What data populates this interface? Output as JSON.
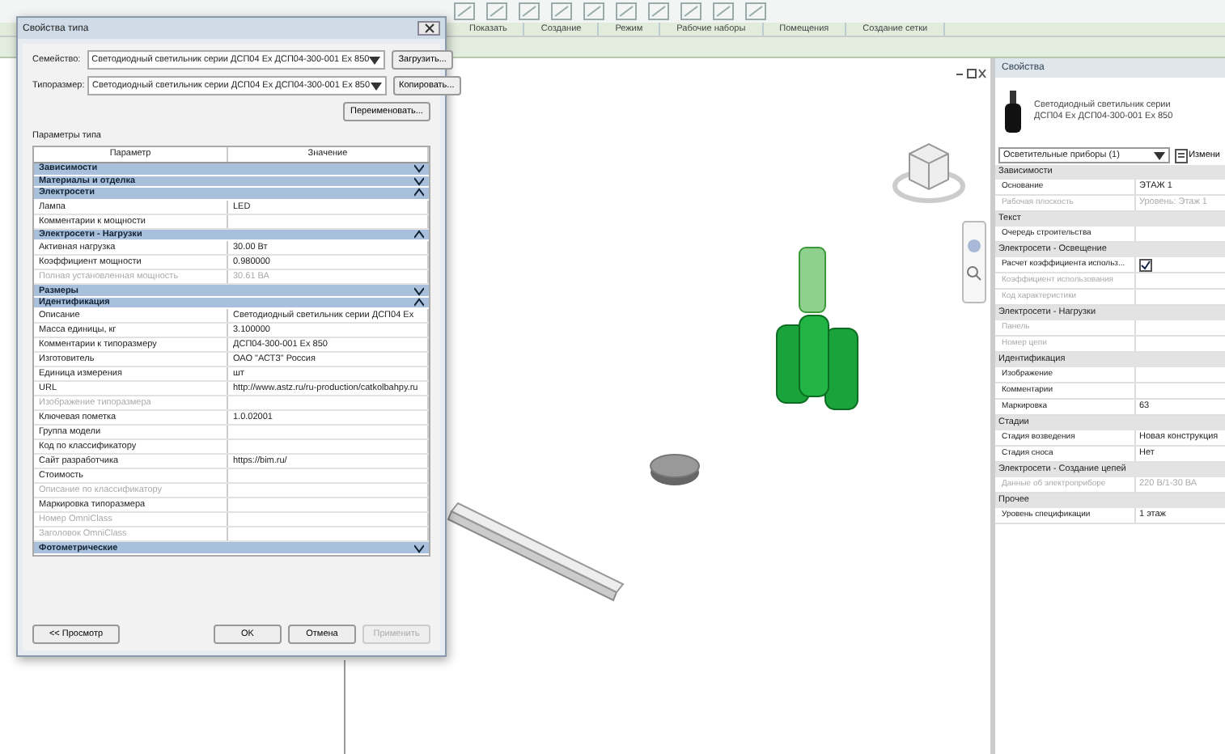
{
  "ribbon": {
    "panels": [
      {
        "label": "Показать"
      },
      {
        "label": "Создание"
      },
      {
        "label": "Режим"
      },
      {
        "label": "Рабочие наборы"
      },
      {
        "label": "Помещения"
      },
      {
        "label": "Создание сетки"
      }
    ]
  },
  "dialog": {
    "title": "Свойства типа",
    "family_label": "Семейство:",
    "family_value": "Светодиодный светильник серии ДСП04 Ex ДСП04-300-001 Ex 850",
    "type_label": "Типоразмер:",
    "type_value": "Светодиодный светильник серии ДСП04 Ex ДСП04-300-001 Ex 850",
    "side_buttons": [
      "Загрузить...",
      "Копировать...",
      "Переименовать..."
    ],
    "section_label": "Параметры типа",
    "columns": [
      "Параметр",
      "Значение"
    ],
    "groups": [
      {
        "name": "Зависимости",
        "expanded": false
      },
      {
        "name": "Материалы и отделка",
        "expanded": false
      },
      {
        "name": "Электросети",
        "expanded": true,
        "rows": [
          {
            "name": "Лампа",
            "value": "LED",
            "disabled": false
          },
          {
            "name": "Комментарии к мощности",
            "value": "",
            "disabled": false
          }
        ]
      },
      {
        "name": "Электросети - Нагрузки",
        "expanded": true,
        "rows": [
          {
            "name": "Активная нагрузка",
            "value": "30.00 Вт",
            "disabled": false
          },
          {
            "name": "Коэффициент мощности",
            "value": "0.980000",
            "disabled": false
          },
          {
            "name": "Полная установленная мощность",
            "value": "30.61 ВА",
            "disabled": true
          }
        ]
      },
      {
        "name": "Размеры",
        "expanded": false
      },
      {
        "name": "Идентификация",
        "expanded": true,
        "rows": [
          {
            "name": "Описание",
            "value": "Светодиодный светильник серии ДСП04 Ex",
            "disabled": false
          },
          {
            "name": "Масса единицы, кг",
            "value": "3.100000",
            "disabled": false
          },
          {
            "name": "Комментарии к типоразмеру",
            "value": "ДСП04-300-001 Ex 850",
            "disabled": false
          },
          {
            "name": "Изготовитель",
            "value": "ОАО \"АСТЗ\" Россия",
            "disabled": false
          },
          {
            "name": "Единица измерения",
            "value": "шт",
            "disabled": false
          },
          {
            "name": "URL",
            "value": "http://www.astz.ru/ru-production/catkolbahpy.ru",
            "disabled": false
          },
          {
            "name": "Изображение типоразмера",
            "value": "",
            "disabled": true
          },
          {
            "name": "Ключевая пометка",
            "value": "1.0.02001",
            "disabled": false
          },
          {
            "name": "Группа модели",
            "value": "",
            "disabled": false
          },
          {
            "name": "Код по классификатору",
            "value": "",
            "disabled": false
          },
          {
            "name": "Сайт разработчика",
            "value": "https://bim.ru/",
            "disabled": false
          },
          {
            "name": "Стоимость",
            "value": "",
            "disabled": false
          },
          {
            "name": "Описание по классификатору",
            "value": "",
            "disabled": true
          },
          {
            "name": "Маркировка типоразмера",
            "value": "",
            "disabled": false
          },
          {
            "name": "Номер OmniClass",
            "value": "",
            "disabled": true
          },
          {
            "name": "Заголовок OmniClass",
            "value": "",
            "disabled": true
          }
        ]
      },
      {
        "name": "Фотометрические",
        "expanded": false
      }
    ],
    "preview_button": "<< Просмотр",
    "buttons": [
      {
        "label": "OK",
        "disabled": false
      },
      {
        "label": "Отмена",
        "disabled": false
      },
      {
        "label": "Применить",
        "disabled": true
      }
    ]
  },
  "properties": {
    "title": "Свойства",
    "type_name": "Светодиодный светильник серии ДСП04 Ex ДСП04-300-001 Ex 850",
    "category": "Осветительные приборы (1)",
    "edit_type": "Измени",
    "groups": [
      {
        "name": "Зависимости",
        "rows": [
          {
            "kind": "text",
            "name": "Основание",
            "value": "ЭТАЖ 1",
            "disabled": false
          },
          {
            "kind": "text",
            "name": "Рабочая плоскость",
            "value": "Уровень: Этаж 1",
            "disabled": true
          }
        ]
      },
      {
        "name": "Текст",
        "rows": [
          {
            "kind": "text",
            "name": "Очередь строительства",
            "value": "",
            "disabled": false
          }
        ]
      },
      {
        "name": "Электросети - Освещение",
        "rows": [
          {
            "kind": "checkbox",
            "name": "Расчет коэффициента использ...",
            "checked": true,
            "disabled": false
          },
          {
            "kind": "text",
            "name": "Коэффициент использования",
            "value": "",
            "disabled": true
          },
          {
            "kind": "text",
            "name": "Код характеристики",
            "value": "",
            "disabled": true
          }
        ]
      },
      {
        "name": "Электросети - Нагрузки",
        "rows": [
          {
            "kind": "text",
            "name": "Панель",
            "value": "",
            "disabled": true
          },
          {
            "kind": "text",
            "name": "Номер цепи",
            "value": "",
            "disabled": true
          }
        ]
      },
      {
        "name": "Идентификация",
        "rows": [
          {
            "kind": "text",
            "name": "Изображение",
            "value": "",
            "disabled": false
          },
          {
            "kind": "text",
            "name": "Комментарии",
            "value": "",
            "disabled": false
          },
          {
            "kind": "text",
            "name": "Маркировка",
            "value": "63",
            "disabled": false
          }
        ]
      },
      {
        "name": "Стадии",
        "rows": [
          {
            "kind": "text",
            "name": "Стадия возведения",
            "value": "Новая конструкция",
            "disabled": false
          },
          {
            "kind": "text",
            "name": "Стадия сноса",
            "value": "Нет",
            "disabled": false
          }
        ]
      },
      {
        "name": "Электросети - Создание цепей",
        "rows": [
          {
            "kind": "text",
            "name": "Данные об электроприборе",
            "value": "220 В/1-30 ВА",
            "disabled": true
          }
        ]
      },
      {
        "name": "Прочее",
        "rows": [
          {
            "kind": "text",
            "name": "Уровень спецификации",
            "value": "1 этаж",
            "disabled": false
          }
        ]
      }
    ]
  }
}
